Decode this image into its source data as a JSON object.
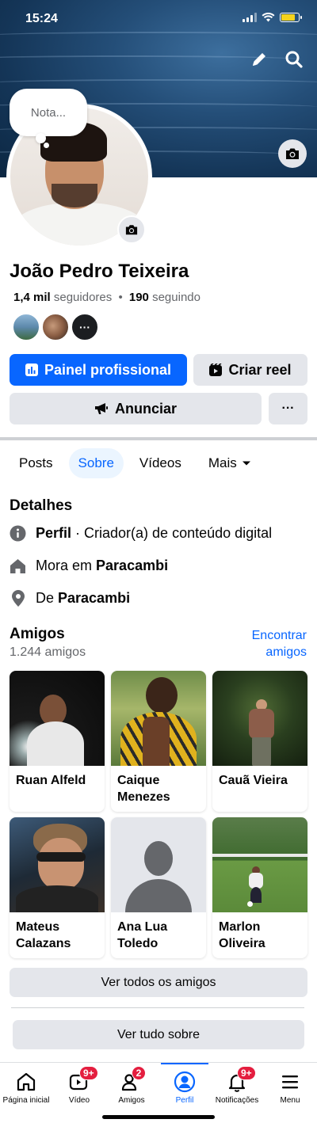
{
  "status_bar": {
    "time": "15:24"
  },
  "cover": {
    "edit_icon": "pencil-icon",
    "search_icon": "search-icon",
    "camera_icon": "camera-icon"
  },
  "note": {
    "placeholder": "Nota..."
  },
  "profile": {
    "name": "João Pedro Teixeira",
    "followers_count": "1,4 mil",
    "followers_label": "seguidores",
    "separator": "•",
    "following_count": "190",
    "following_label": "seguindo",
    "more_avatars_label": "···"
  },
  "actions": {
    "professional_dashboard": "Painel profissional",
    "create_reel": "Criar reel",
    "advertise": "Anunciar",
    "more": "···"
  },
  "tabs": [
    {
      "label": "Posts",
      "active": false
    },
    {
      "label": "Sobre",
      "active": true
    },
    {
      "label": "Vídeos",
      "active": false
    },
    {
      "label": "Mais",
      "active": false
    }
  ],
  "details": {
    "title": "Detalhes",
    "profile_strong": "Perfil",
    "profile_rest": " · Criador(a) de conteúdo digital",
    "lives_prefix": "Mora em ",
    "lives_city": "Paracambi",
    "from_prefix": "De ",
    "from_city": "Paracambi"
  },
  "friends": {
    "title": "Amigos",
    "count": "1.244 amigos",
    "find_line1": "Encontrar",
    "find_line2": "amigos",
    "items": [
      {
        "first": "Ruan Alfeld",
        "second": ""
      },
      {
        "first": "Caique",
        "second": "Menezes"
      },
      {
        "first": "Cauã Vieira",
        "second": ""
      },
      {
        "first": "Mateus",
        "second": "Calazans"
      },
      {
        "first": "Ana Lua",
        "second": "Toledo"
      },
      {
        "first": "Marlon",
        "second": "Oliveira"
      }
    ],
    "see_all": "Ver todos os amigos"
  },
  "see_all_about": "Ver tudo sobre",
  "bottom_nav": [
    {
      "label": "Página inicial",
      "icon": "home-icon",
      "badge": ""
    },
    {
      "label": "Vídeo",
      "icon": "video-icon",
      "badge": "9+"
    },
    {
      "label": "Amigos",
      "icon": "friends-icon",
      "badge": "2"
    },
    {
      "label": "Perfil",
      "icon": "profile-icon",
      "badge": "",
      "active": true
    },
    {
      "label": "Notificações",
      "icon": "bell-icon",
      "badge": "9+"
    },
    {
      "label": "Menu",
      "icon": "menu-icon",
      "badge": ""
    }
  ],
  "colors": {
    "accent": "#0866ff",
    "badge": "#e41e3f",
    "button_gray": "#e4e6eb",
    "muted_text": "#65676b"
  }
}
